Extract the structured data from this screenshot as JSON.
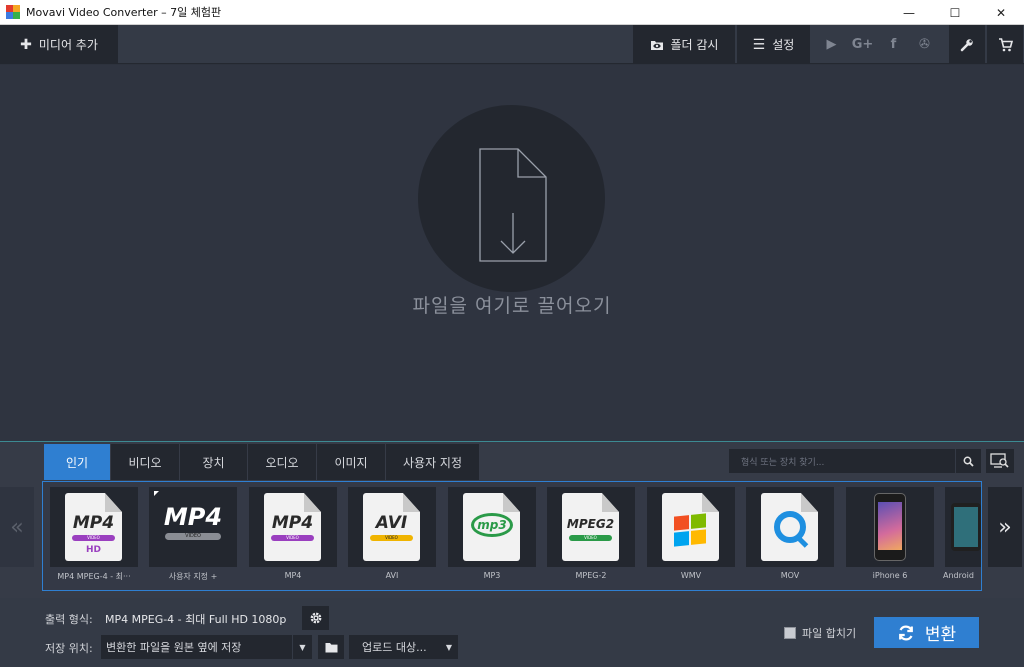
{
  "window": {
    "title": "Movavi Video Converter – 7일 체험판",
    "controls": {
      "minimize": "—",
      "maximize": "☐",
      "close": "✕"
    }
  },
  "toolbar": {
    "add_media": {
      "icon": "plus-icon",
      "glyph": "✚",
      "label": "미디어 추가"
    },
    "folder_watch": {
      "icon": "eye-folder-icon",
      "label": "폴더 감시"
    },
    "settings": {
      "icon": "hamburger-menu-icon",
      "glyph": "☰",
      "label": "설정"
    },
    "social": [
      {
        "name": "youtube-icon",
        "glyph": "▶"
      },
      {
        "name": "google-plus-icon",
        "glyph": "G+"
      },
      {
        "name": "facebook-icon",
        "glyph": "f"
      },
      {
        "name": "vk-icon",
        "glyph": "✇"
      }
    ],
    "tools": {
      "icon": "wrench-icon",
      "glyph": "🔧"
    },
    "cart": {
      "icon": "cart-icon",
      "glyph": "🛒"
    }
  },
  "dropzone": {
    "icon": "file-download-icon",
    "text": "파일을 여기로 끌어오기"
  },
  "formats": {
    "tabs": [
      {
        "label": "인기",
        "active": true
      },
      {
        "label": "비디오",
        "active": false
      },
      {
        "label": "장치",
        "active": false
      },
      {
        "label": "오디오",
        "active": false
      },
      {
        "label": "이미지",
        "active": false
      },
      {
        "label": "사용자 지정",
        "active": false
      }
    ],
    "search_placeholder": "형식 또는 장치 찾기...",
    "search_icon": "search-icon",
    "detect_icon": "device-detect-icon",
    "nav": {
      "prev": "«",
      "next": "»"
    },
    "items": [
      {
        "label": "MP4 MPEG-4 - 최···",
        "badge": "MP4",
        "ribbon": "VIDEO",
        "ribbon_color": "#9a3fbf",
        "extra": "HD"
      },
      {
        "label": "사용자 지정 +",
        "badge": "MP4",
        "ribbon": "VIDEO"
      },
      {
        "label": "MP4",
        "badge": "MP4",
        "ribbon": "VIDEO",
        "ribbon_color": "#9a3fbf"
      },
      {
        "label": "AVI",
        "badge": "AVI",
        "ribbon": "VIDEO",
        "ribbon_color": "#f0b400"
      },
      {
        "label": "MP3",
        "badge": "mp3",
        "ribbon_color": "#2a9a48"
      },
      {
        "label": "MPEG-2",
        "badge": "MPEG2",
        "ribbon": "VIDEO",
        "ribbon_color": "#2a9a48"
      },
      {
        "label": "WMV",
        "icon": "windows-logo-icon"
      },
      {
        "label": "MOV",
        "icon": "quicktime-logo-icon"
      },
      {
        "label": "iPhone 6",
        "icon": "iphone-icon"
      },
      {
        "label": "Android",
        "icon": "android-tablet-icon"
      }
    ]
  },
  "bottom": {
    "output_label": "출력 형식:",
    "output_value": "MP4 MPEG-4 - 최대 Full HD 1080p",
    "save_label": "저장 위치:",
    "save_value": "변환한 파일을 원본 옆에 저장",
    "upload_label": "업로드 대상...",
    "merge_label": "파일 합치기",
    "convert_label": "변환"
  },
  "colors": {
    "accent": "#2f7fd1",
    "panel": "#343a46",
    "dark_button": "#23272f",
    "drop_bg": "#2f3440"
  }
}
